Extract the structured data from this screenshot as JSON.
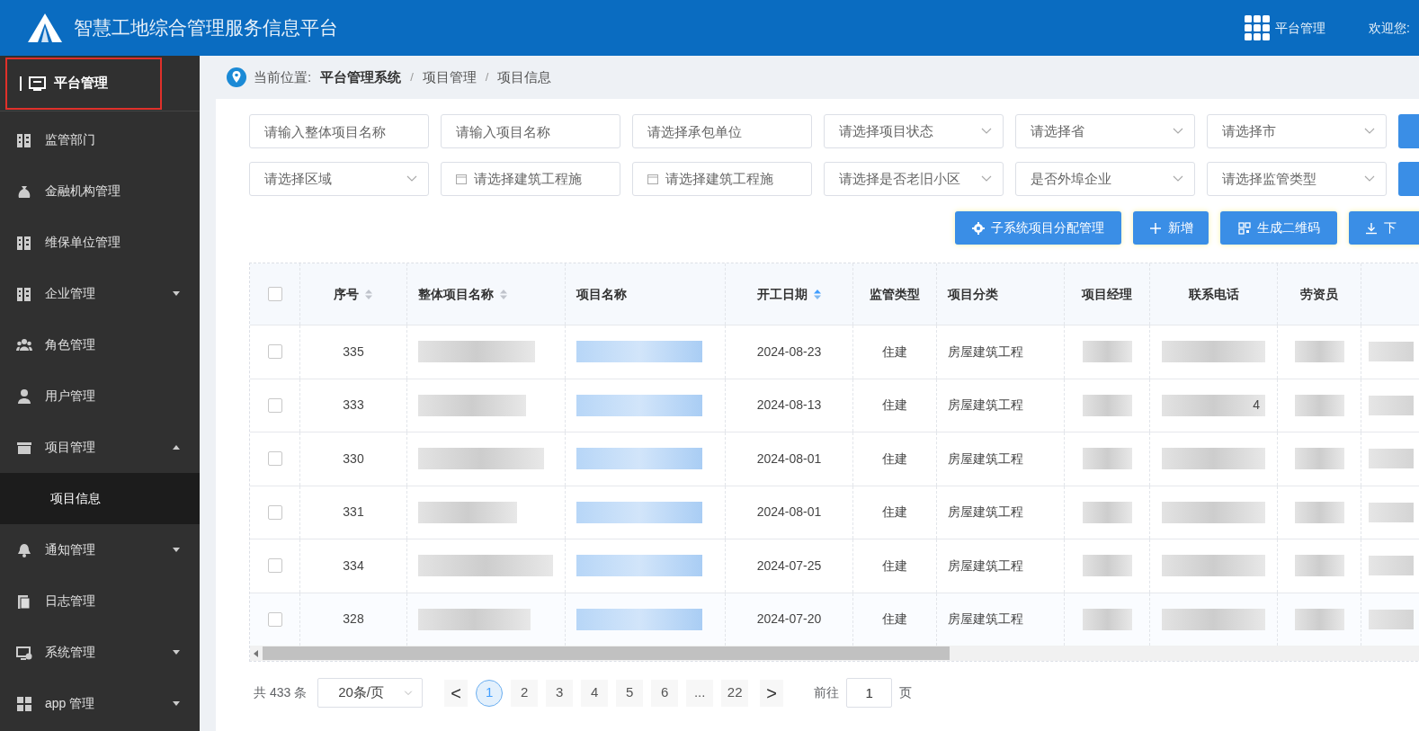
{
  "header": {
    "title": "智慧工地综合管理服务信息平台",
    "menu_label": "平台管理",
    "welcome": "欢迎您:"
  },
  "sidebar": {
    "title": "平台管理",
    "items": [
      {
        "label": "监管部门",
        "kind": "link"
      },
      {
        "label": "金融机构管理",
        "kind": "link"
      },
      {
        "label": "维保单位管理",
        "kind": "link"
      },
      {
        "label": "企业管理",
        "kind": "group",
        "expanded": false
      },
      {
        "label": "角色管理",
        "kind": "link"
      },
      {
        "label": "用户管理",
        "kind": "link"
      },
      {
        "label": "项目管理",
        "kind": "group",
        "expanded": true,
        "children": [
          {
            "label": "项目信息",
            "selected": true
          }
        ]
      },
      {
        "label": "通知管理",
        "kind": "group",
        "expanded": false
      },
      {
        "label": "日志管理",
        "kind": "link"
      },
      {
        "label": "系统管理",
        "kind": "group",
        "expanded": false
      },
      {
        "label": "app 管理",
        "kind": "group",
        "expanded": false
      }
    ]
  },
  "breadcrumb": {
    "label": "当前位置:",
    "items": [
      {
        "kind": "current",
        "text": "平台管理系统"
      },
      {
        "kind": "sep",
        "text": "/"
      },
      {
        "kind": "link",
        "text": "项目管理"
      },
      {
        "kind": "sep",
        "text": "/"
      },
      {
        "kind": "link",
        "text": "项目信息"
      }
    ]
  },
  "filters": [
    [
      {
        "kind": "input",
        "placeholder": "请输入整体项目名称"
      },
      {
        "kind": "input",
        "placeholder": "请输入项目名称"
      },
      {
        "kind": "input",
        "placeholder": "请选择承包单位"
      },
      {
        "kind": "select",
        "placeholder": "请选择项目状态"
      },
      {
        "kind": "select",
        "placeholder": "请选择省"
      },
      {
        "kind": "select",
        "placeholder": "请选择市"
      }
    ],
    [
      {
        "kind": "select",
        "placeholder": "请选择区域"
      },
      {
        "kind": "date",
        "placeholder": "请选择建筑工程施"
      },
      {
        "kind": "date",
        "placeholder": "请选择建筑工程施"
      },
      {
        "kind": "select",
        "placeholder": "请选择是否老旧小区"
      },
      {
        "kind": "select",
        "placeholder": "是否外埠企业"
      },
      {
        "kind": "select",
        "placeholder": "请选择监管类型"
      }
    ]
  ],
  "actions": [
    {
      "kind": "gear",
      "label": "子系统项目分配管理"
    },
    {
      "kind": "plus",
      "label": "新增"
    },
    {
      "kind": "qr",
      "label": "生成二维码"
    },
    {
      "kind": "download",
      "label": "下"
    }
  ],
  "table": {
    "all_checked": false,
    "columns": [
      {
        "kind": "check"
      },
      {
        "kind": "text",
        "label": "序号",
        "sorted": false
      },
      {
        "kind": "blur",
        "label": "整体项目名称",
        "sorted": false
      },
      {
        "kind": "blurlink",
        "label": "项目名称"
      },
      {
        "kind": "text",
        "label": "开工日期",
        "sorted": true
      },
      {
        "kind": "text",
        "label": "监管类型"
      },
      {
        "kind": "textleft",
        "label": "项目分类"
      },
      {
        "kind": "blur",
        "label": "项目经理"
      },
      {
        "kind": "blur",
        "label": "联系电话"
      },
      {
        "kind": "blur",
        "label": "劳资员"
      }
    ],
    "rows": [
      {
        "checked": false,
        "cells": [
          "",
          "335",
          "",
          "",
          "2024-08-23",
          "住建",
          "房屋建筑工程",
          "",
          "",
          ""
        ]
      },
      {
        "checked": false,
        "cells": [
          "",
          "333",
          "",
          "",
          "2024-08-13",
          "住建",
          "房屋建筑工程",
          "",
          "4",
          ""
        ]
      },
      {
        "checked": false,
        "cells": [
          "",
          "330",
          "",
          "",
          "2024-08-01",
          "住建",
          "房屋建筑工程",
          "",
          "",
          ""
        ]
      },
      {
        "checked": false,
        "cells": [
          "",
          "331",
          "",
          "",
          "2024-08-01",
          "住建",
          "房屋建筑工程",
          "",
          "",
          ""
        ]
      },
      {
        "checked": false,
        "cells": [
          "",
          "334",
          "",
          "",
          "2024-07-25",
          "住建",
          "房屋建筑工程",
          "",
          "",
          ""
        ]
      },
      {
        "checked": false,
        "cells": [
          "",
          "328",
          "",
          "",
          "2024-07-20",
          "住建",
          "房屋建筑工程",
          "",
          "",
          ""
        ]
      }
    ]
  },
  "pagination": {
    "total": "共 433 条",
    "page_size": "20条/页",
    "prev": "<",
    "pages": [
      {
        "label": "1",
        "selected": true
      },
      {
        "label": "2",
        "selected": false
      },
      {
        "label": "3",
        "selected": false
      },
      {
        "label": "4",
        "selected": false
      },
      {
        "label": "5",
        "selected": false
      },
      {
        "label": "6",
        "selected": false
      },
      {
        "label": "...",
        "selected": false
      },
      {
        "label": "22",
        "selected": false
      }
    ],
    "next": ">",
    "goto": "前往",
    "goto_value": "1",
    "page_unit": "页"
  }
}
